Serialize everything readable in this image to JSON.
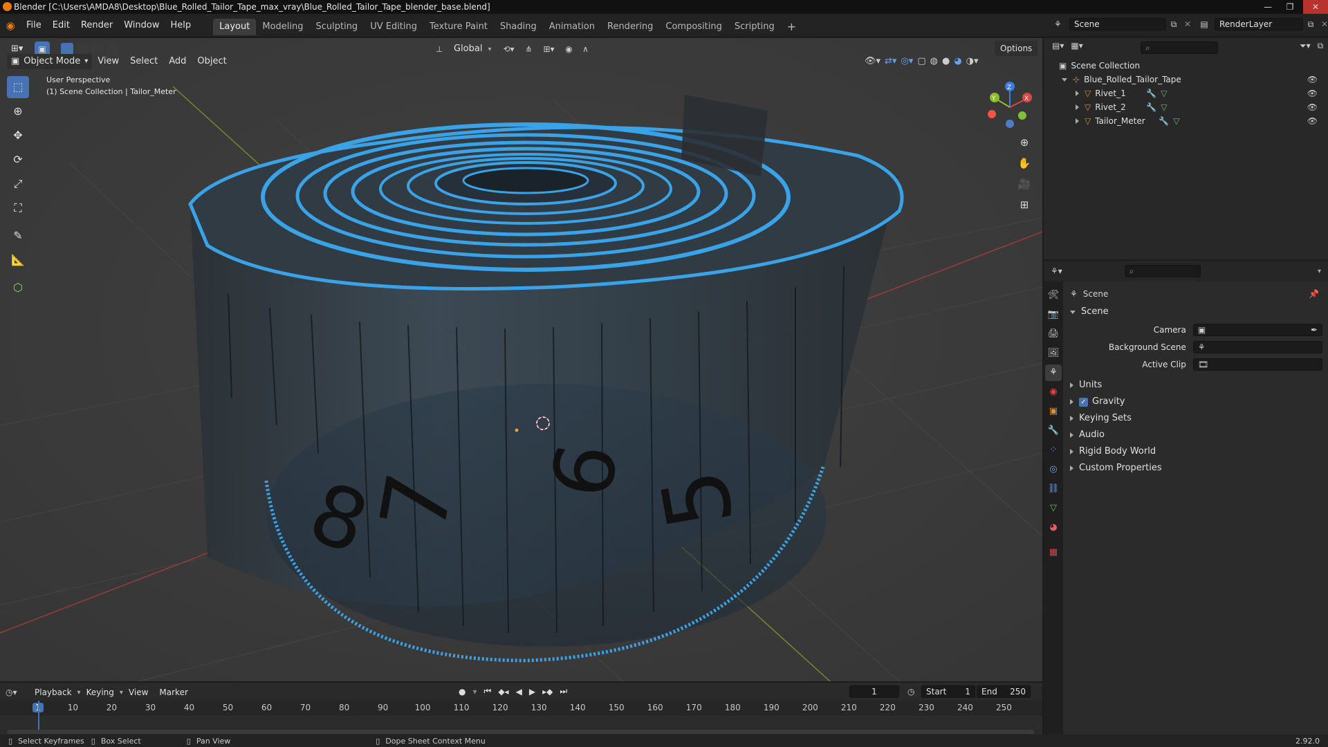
{
  "window": {
    "title": "Blender [C:\\Users\\AMDA8\\Desktop\\Blue_Rolled_Tailor_Tape_max_vray\\Blue_Rolled_Tailor_Tape_blender_base.blend]"
  },
  "menu": {
    "items": [
      "File",
      "Edit",
      "Render",
      "Window",
      "Help"
    ]
  },
  "workspaces": {
    "tabs": [
      "Layout",
      "Modeling",
      "Sculpting",
      "UV Editing",
      "Texture Paint",
      "Shading",
      "Animation",
      "Rendering",
      "Compositing",
      "Scripting"
    ],
    "active": "Layout",
    "add": "+"
  },
  "scene_selector": {
    "value": "Scene"
  },
  "view_layer_selector": {
    "value": "RenderLayer"
  },
  "viewport_header": {
    "transform_orientation": "Global",
    "options": "Options",
    "mode": "Object Mode",
    "menus": [
      "View",
      "Select",
      "Add",
      "Object"
    ]
  },
  "viewport": {
    "perspective_label": "User Perspective",
    "collection_label": "(1) Scene Collection | Tailor_Meter",
    "gizmo": {
      "x": "X",
      "y": "Y",
      "z": "Z"
    },
    "ruler_numbers": [
      "8",
      "7",
      "6",
      "5"
    ]
  },
  "outliner": {
    "root": "Scene Collection",
    "collection": "Blue_Rolled_Tailor_Tape",
    "objects": [
      "Rivet_1",
      "Rivet_2",
      "Tailor_Meter"
    ]
  },
  "properties": {
    "header": "Scene",
    "panel_title": "Scene",
    "fields": [
      {
        "label": "Camera",
        "value": ""
      },
      {
        "label": "Background Scene",
        "value": ""
      },
      {
        "label": "Active Clip",
        "value": ""
      }
    ],
    "subpanels": [
      "Units",
      "Gravity",
      "Keying Sets",
      "Audio",
      "Rigid Body World",
      "Custom Properties"
    ],
    "gravity_checked": true
  },
  "timeline": {
    "menus": [
      "Playback",
      "Keying",
      "View",
      "Marker"
    ],
    "current_frame": "1",
    "start_label": "Start",
    "start": "1",
    "end_label": "End",
    "end": "250",
    "ticks": [
      "1",
      "10",
      "20",
      "30",
      "40",
      "50",
      "60",
      "70",
      "80",
      "90",
      "100",
      "110",
      "120",
      "130",
      "140",
      "150",
      "160",
      "170",
      "180",
      "190",
      "200",
      "210",
      "220",
      "230",
      "240",
      "250"
    ]
  },
  "statusbar": {
    "items": [
      "Select Keyframes",
      "Box Select",
      "Pan View",
      "Dope Sheet Context Menu"
    ],
    "version": "2.92.0"
  },
  "colors": {
    "accent": "#4772b3",
    "tape_blue": "#3aa3e8",
    "orange": "#e87d0d"
  }
}
